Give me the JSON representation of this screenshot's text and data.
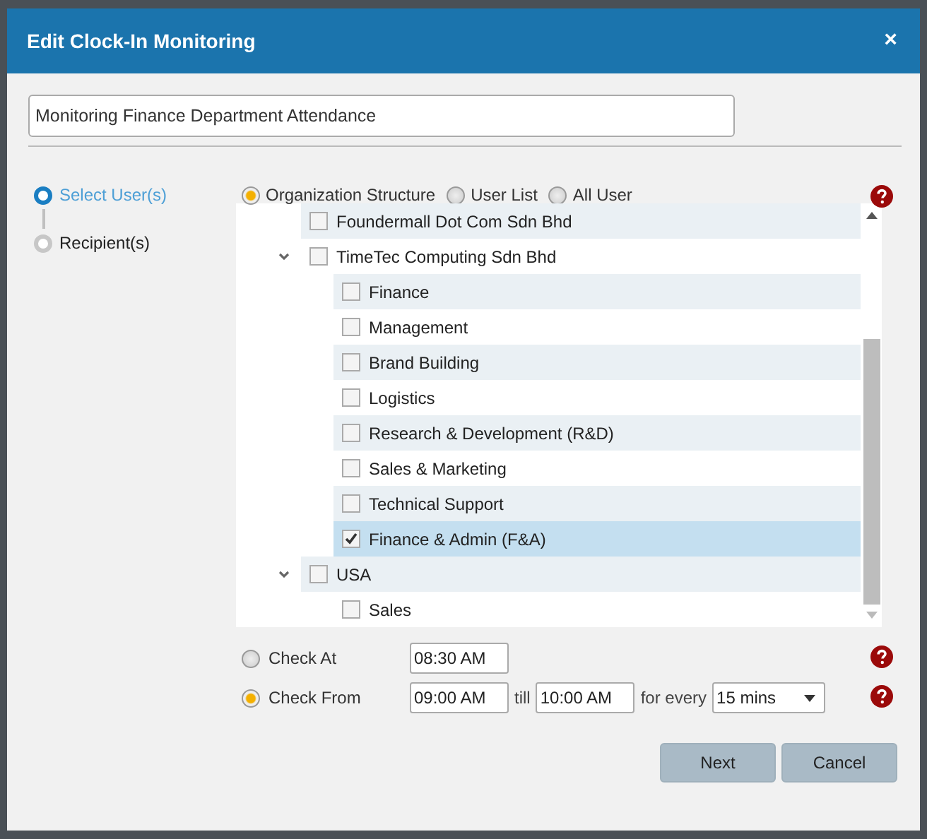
{
  "dialog": {
    "title": "Edit Clock-In Monitoring",
    "close": "×"
  },
  "name_field": {
    "value": "Monitoring Finance Department Attendance"
  },
  "steps": [
    {
      "label": "Select User(s)",
      "selected": true
    },
    {
      "label": "Recipient(s)",
      "selected": false
    }
  ],
  "source_options": [
    {
      "label": "Organization Structure",
      "selected": true
    },
    {
      "label": "User List",
      "selected": false
    },
    {
      "label": "All User",
      "selected": false
    }
  ],
  "tree": [
    {
      "label": "Foundermall Dot Com Sdn Bhd",
      "checked": false
    },
    {
      "label": "TimeTec Computing Sdn Bhd",
      "checked": false,
      "expanded": true,
      "children": [
        {
          "label": "Finance",
          "checked": false
        },
        {
          "label": "Management",
          "checked": false
        },
        {
          "label": "Brand Building",
          "checked": false
        },
        {
          "label": "Logistics",
          "checked": false
        },
        {
          "label": "Research & Development (R&D)",
          "checked": false
        },
        {
          "label": "Sales & Marketing",
          "checked": false
        },
        {
          "label": "Technical Support",
          "checked": false
        },
        {
          "label": "Finance & Admin (F&A)",
          "checked": true
        }
      ]
    },
    {
      "label": "USA",
      "checked": false,
      "expanded": true,
      "children": [
        {
          "label": "Sales",
          "checked": false
        }
      ]
    }
  ],
  "check_at": {
    "label": "Check At",
    "selected": false,
    "time": "08:30 AM"
  },
  "check_from": {
    "label": "Check From",
    "selected": true,
    "from": "09:00 AM",
    "till_label": "till",
    "till": "10:00 AM",
    "every_label": "for every",
    "interval": "15 mins"
  },
  "buttons": [
    "Next",
    "Cancel"
  ]
}
